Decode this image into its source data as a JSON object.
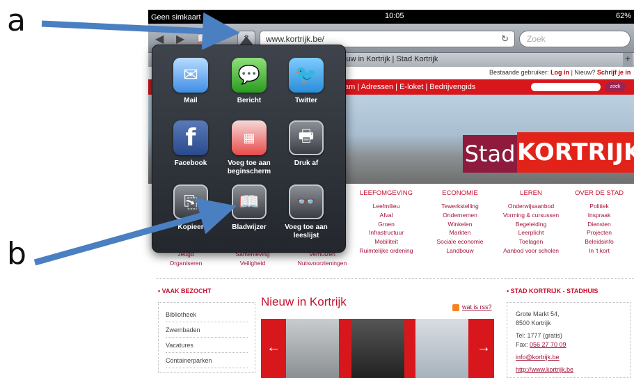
{
  "annotations": {
    "a": "a",
    "b": "b",
    "arrow_color": "#4a7fc1"
  },
  "status_bar": {
    "carrier": "Geen simkaart ᯤ",
    "time": "10:05",
    "battery": "62%"
  },
  "safari": {
    "share_icon": "share-icon",
    "url": "www.kortrijk.be/",
    "search_placeholder": "Zoek",
    "reload_icon": "↻",
    "tab_title": "Nieuw in Kortrijk | Stad Kortrijk",
    "new_tab": "+"
  },
  "site": {
    "login_prefix": "Bestaande gebruiker: ",
    "login": "Log in",
    "sep": " | ",
    "new_prefix": "Nieuw? ",
    "signup": "Schrijf je in",
    "nav": "am  |  Adressen  |  E-loket  |  Bedrijvengids",
    "search_button": "zoek",
    "stad": "Stad",
    "kortrijk": "KORTRIJK",
    "categories": [
      {
        "head": "LEEFOMGEVING",
        "items": [
          "Leefmilieu",
          "Afval",
          "Groen",
          "Infrastructuur",
          "Mobiliteit",
          "Ruimtelijke ordening"
        ]
      },
      {
        "head": "ECONOMIE",
        "items": [
          "Tewerkstelling",
          "Ondernemen",
          "Winkelen",
          "Markten",
          "Sociale economie",
          "Landbouw"
        ]
      },
      {
        "head": "LEREN",
        "items": [
          "Onderwijsaanbod",
          "Vorming & cursussen",
          "Begeleiding",
          "Leerplicht",
          "Toelagen",
          "Aanbod voor scholen"
        ]
      },
      {
        "head": "OVER DE STAD",
        "items": [
          "Politiek",
          "Inspraak",
          "Diensten",
          "Projecten",
          "Beleidsinfo",
          "In 't kort"
        ]
      }
    ],
    "lower_left": [
      "Jeugd",
      "Organiseren"
    ],
    "lower_mid": [
      "Samenleving",
      "Veiligheid"
    ],
    "lower_right": [
      "Verhuizen",
      "Nutsvoorzieningen"
    ],
    "vaak_title": "• VAAK BEZOCHT",
    "vaak_items": [
      "Bibliotheek",
      "Zwembaden",
      "Vacatures",
      "Containerparken"
    ],
    "nieuw_title": "Nieuw in Kortrijk",
    "rss": "wat is rss?",
    "prev_arrow": "←",
    "next_arrow": "→",
    "stadhuis_title": "• STAD KORTRIJK - STADHUIS",
    "address_1": "Grote Markt 54,",
    "address_2": "8500 Kortrijk",
    "tel": "Tel: 1777 (gratis)",
    "fax_prefix": "Fax: ",
    "fax": "056 27 70 09",
    "email": "info@kortrijk.be",
    "web": "http://www.kortrijk.be"
  },
  "share_sheet": {
    "items": [
      {
        "label": "Mail",
        "glyph": "✉",
        "icon": "mail-icon"
      },
      {
        "label": "Bericht",
        "glyph": "💬",
        "icon": "message-icon"
      },
      {
        "label": "Twitter",
        "glyph": "🐦",
        "icon": "twitter-icon"
      },
      {
        "label": "Facebook",
        "glyph": "f",
        "icon": "facebook-icon"
      },
      {
        "label": "Voeg toe aan beginscherm",
        "glyph": "▦",
        "icon": "homescreen-icon"
      },
      {
        "label": "Druk af",
        "glyph": "🖶",
        "icon": "print-icon"
      },
      {
        "label": "Kopieer",
        "glyph": "⎘",
        "icon": "copy-icon"
      },
      {
        "label": "Bladwijzer",
        "glyph": "📖",
        "icon": "bookmark-icon"
      },
      {
        "label": "Voeg toe aan leeslijst",
        "glyph": "👓",
        "icon": "reading-list-icon"
      }
    ]
  }
}
